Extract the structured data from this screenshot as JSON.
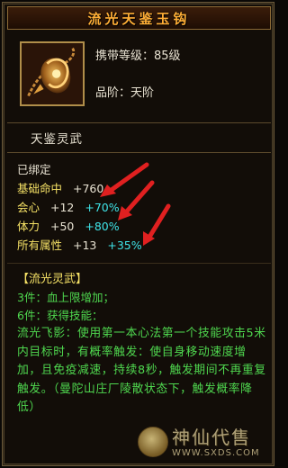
{
  "item": {
    "name": "流光天鉴玉钩",
    "carry_level_label": "携带等级：",
    "carry_level_value": "85级",
    "grade_label": "品阶：",
    "grade_value": "天阶",
    "type": "天鉴灵武",
    "icon": "hook-weapon-icon"
  },
  "attributes": {
    "bound": "已绑定",
    "rows": [
      {
        "label": "基础命中",
        "base": "+760",
        "bonus": ""
      },
      {
        "label": "会心",
        "base": "+12",
        "bonus": "+70%"
      },
      {
        "label": "体力",
        "base": "+50",
        "bonus": "+80%"
      },
      {
        "label": "所有属性",
        "base": "+13",
        "bonus": "+35%"
      }
    ]
  },
  "set": {
    "title": "【流光灵武】",
    "piece3": "3件：血上限增加；",
    "piece6": "6件：获得技能：",
    "skill_desc": "流光飞影：使用第一本心法第一个技能攻击5米内目标时，有概率触发：使自身移动速度增加，且免疫减速，持续8秒，触发期间不再重复触发。（曼陀山庄厂陵散状态下，触发概率降低）"
  },
  "watermark": {
    "main": "神仙代售",
    "url": "WWW.SXDS.COM"
  },
  "colors": {
    "title": "#ffae36",
    "attr_label": "#f6e266",
    "bonus": "#3fe4e8",
    "set_text": "#4fd84f",
    "arrow": "#e02020"
  }
}
